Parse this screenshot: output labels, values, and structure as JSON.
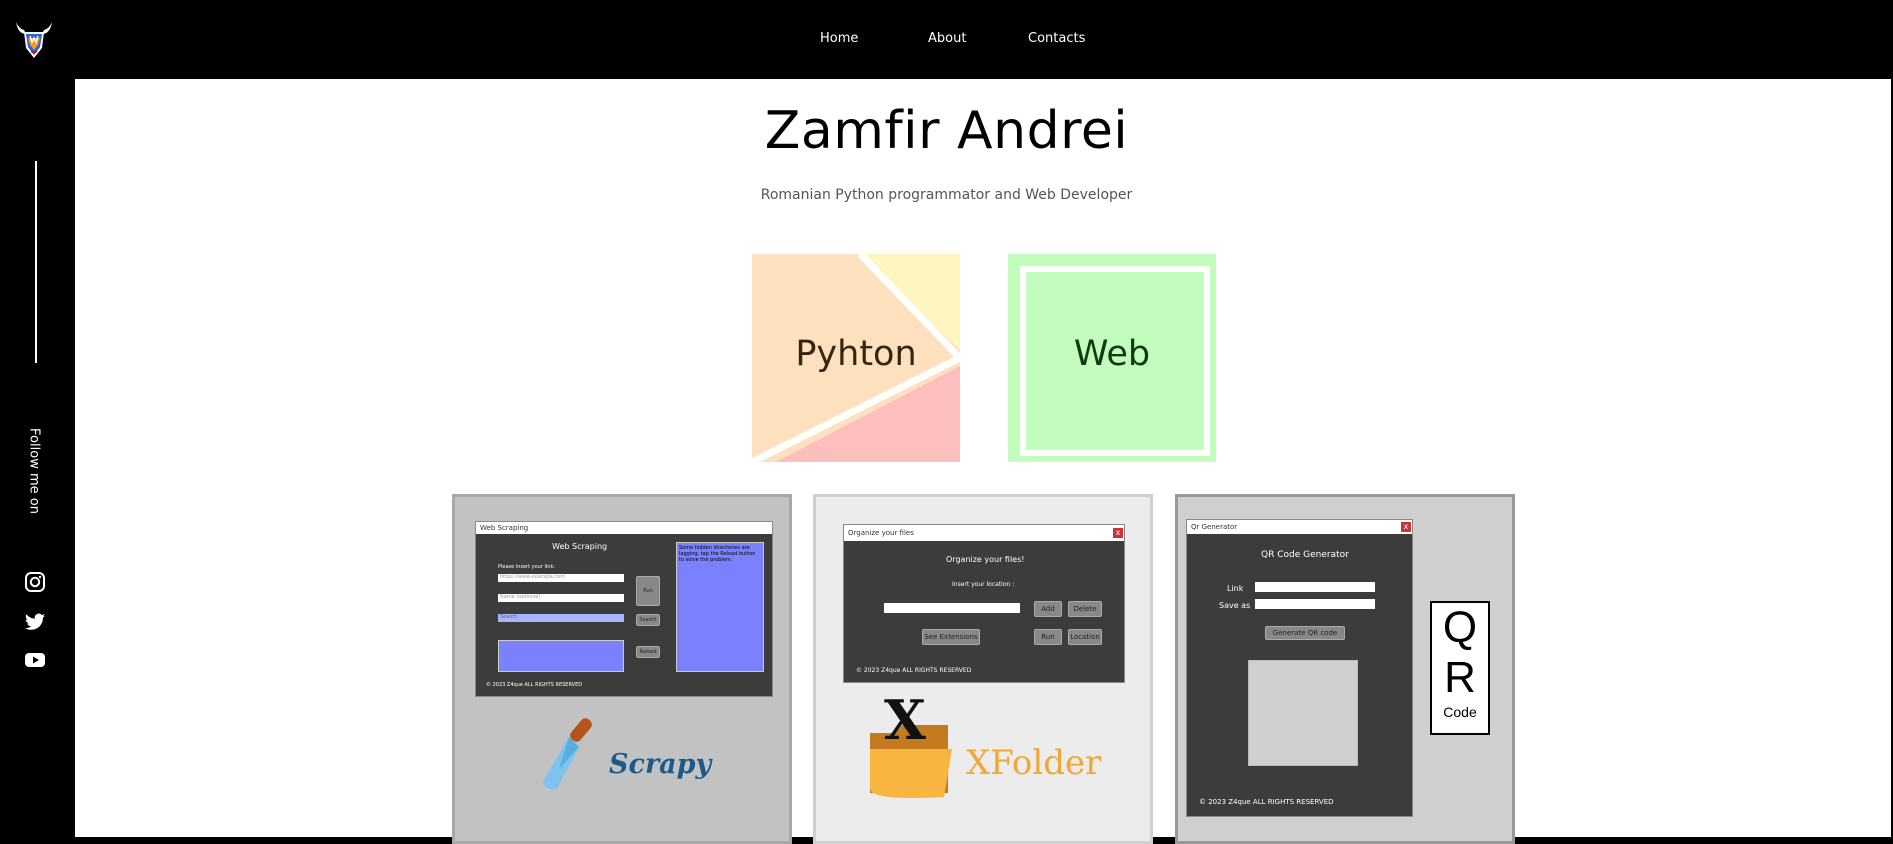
{
  "nav": {
    "home": "Home",
    "about": "About",
    "contacts": "Contacts"
  },
  "sidebar": {
    "follow_text": "Follow me on",
    "social_icons": [
      "instagram-icon",
      "twitter-icon",
      "youtube-icon"
    ]
  },
  "hero": {
    "title": "Zamfir Andrei",
    "subtitle": "Romanian Python programmator and Web Developer"
  },
  "tiles": {
    "python_label": "Pyhton",
    "web_label": "Web"
  },
  "projects": {
    "scrapy": {
      "window_title": "Web Scraping",
      "heading": "Web Scraping",
      "prompt": "Please insert your link:",
      "link_placeholder": "https://www.example.com",
      "name_placeholder": "Name (optional)",
      "search_placeholder": "Search",
      "run": "Run",
      "search": "Search",
      "reload": "Reload",
      "notice": "Some hidden directories are lagging, tap the Reload button to solve the problem.",
      "footer": "© 2023 Z4que ALL RIGHTS RESERVED",
      "logo_text": "Scrapy"
    },
    "xfolder": {
      "window_title": "Organize your files",
      "heading": "Organize your files!",
      "prompt": "Insert your location :",
      "add": "Add",
      "delete": "Delete",
      "see_extensions": "See Extensions",
      "run": "Run",
      "location": "Location",
      "footer": "© 2023 Z4que ALL RIGHTS RESERVED",
      "logo_text": "XFolder",
      "logo_letter": "X"
    },
    "qr": {
      "window_title": "Qr Generator",
      "heading": "QR Code Generator",
      "link_label": "Link",
      "save_label": "Save as",
      "generate": "Generate QR code",
      "footer": "© 2023 Z4que ALL RIGHTS RESERVED",
      "logo_q": "Q",
      "logo_r": "R",
      "logo_code": "Code"
    }
  },
  "colors": {
    "python_peach": "#fde0bd",
    "python_yellow": "#fdf6c0",
    "python_pink": "#fdbebe",
    "web_green": "#c3fdbd",
    "card_gray": "#c2c2c2",
    "scrapy_blue": "#1b5a8c",
    "xfolder_orange": "#f2a733"
  }
}
